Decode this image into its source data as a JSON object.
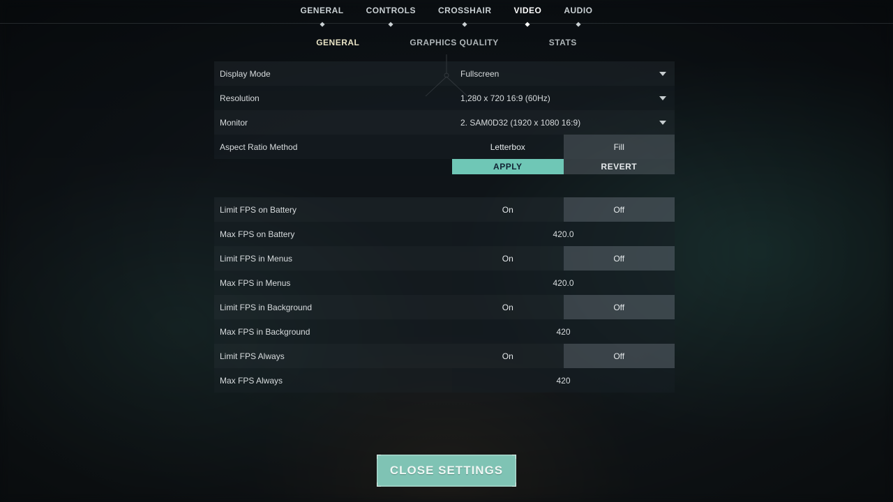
{
  "main_tabs": {
    "items": [
      "GENERAL",
      "CONTROLS",
      "CROSSHAIR",
      "VIDEO",
      "AUDIO"
    ],
    "active": "VIDEO"
  },
  "sub_tabs": {
    "items": [
      "GENERAL",
      "GRAPHICS QUALITY",
      "STATS"
    ],
    "active": "GENERAL"
  },
  "settings": {
    "display_mode": {
      "label": "Display Mode",
      "value": "Fullscreen"
    },
    "resolution": {
      "label": "Resolution",
      "value": "1,280 x 720 16:9 (60Hz)"
    },
    "monitor": {
      "label": "Monitor",
      "value": "2. SAM0D32 (1920 x  1080 16:9)"
    },
    "aspect_ratio": {
      "label": "Aspect Ratio Method",
      "options": [
        "Letterbox",
        "Fill"
      ],
      "selected": "Fill"
    },
    "apply_label": "APPLY",
    "revert_label": "REVERT",
    "limit_fps_battery": {
      "label": "Limit FPS on Battery",
      "options": [
        "On",
        "Off"
      ],
      "selected": "Off"
    },
    "max_fps_battery": {
      "label": "Max FPS on Battery",
      "value": "420.0"
    },
    "limit_fps_menus": {
      "label": "Limit FPS in Menus",
      "options": [
        "On",
        "Off"
      ],
      "selected": "Off"
    },
    "max_fps_menus": {
      "label": "Max FPS in Menus",
      "value": "420.0"
    },
    "limit_fps_background": {
      "label": "Limit FPS in Background",
      "options": [
        "On",
        "Off"
      ],
      "selected": "Off"
    },
    "max_fps_background": {
      "label": "Max FPS in Background",
      "value": "420"
    },
    "limit_fps_always": {
      "label": "Limit FPS Always",
      "options": [
        "On",
        "Off"
      ],
      "selected": "Off"
    },
    "max_fps_always": {
      "label": "Max FPS Always",
      "value": "420"
    }
  },
  "close_label": "CLOSE SETTINGS"
}
